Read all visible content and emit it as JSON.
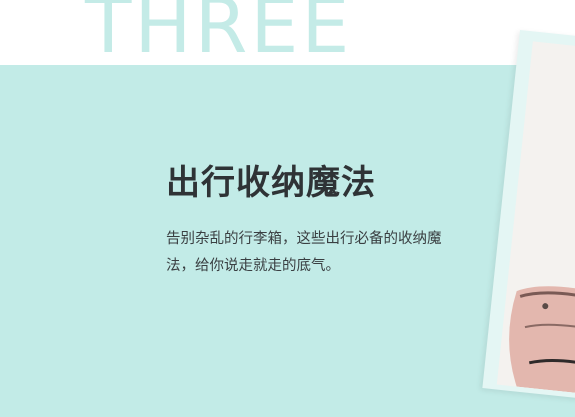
{
  "section": {
    "number_label": "THREE"
  },
  "content": {
    "headline": "出行收纳魔法",
    "description": "告别杂乱的行李箱，这些出行必备的收纳魔法，给你说走就走的底气。"
  },
  "colors": {
    "mint_panel": "#c2ebe7",
    "number_text": "#c4ebe7",
    "headline_text": "#2f3336",
    "body_text": "#3a3f42"
  }
}
